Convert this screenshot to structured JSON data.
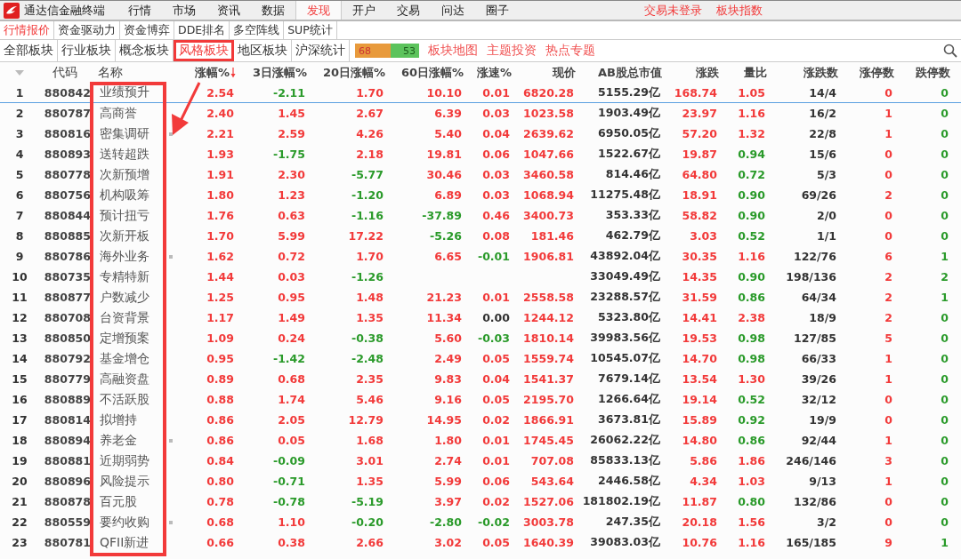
{
  "app": {
    "title": "通达信金融终端"
  },
  "menu": [
    {
      "label": "行情",
      "selected": false
    },
    {
      "label": "市场",
      "selected": false
    },
    {
      "label": "资讯",
      "selected": false
    },
    {
      "label": "数据",
      "selected": false
    },
    {
      "label": "发现",
      "selected": true
    },
    {
      "label": "开户",
      "selected": false
    },
    {
      "label": "交易",
      "selected": false
    },
    {
      "label": "问达",
      "selected": false
    },
    {
      "label": "圈子",
      "selected": false
    }
  ],
  "status_links": [
    "交易未登录",
    "板块指数"
  ],
  "sub_tabs": [
    {
      "label": "行情报价",
      "selected": true
    },
    {
      "label": "资金驱动力",
      "selected": false
    },
    {
      "label": "资金博弈",
      "selected": false
    },
    {
      "label": "DDE排名",
      "selected": false
    },
    {
      "label": "多空阵线",
      "selected": false
    },
    {
      "label": "SUP统计",
      "selected": false
    }
  ],
  "block_tabs": [
    {
      "label": "全部板块",
      "selected": false
    },
    {
      "label": "行业板块",
      "selected": false
    },
    {
      "label": "概念板块",
      "selected": false
    },
    {
      "label": "风格板块",
      "selected": true
    },
    {
      "label": "地区板块",
      "selected": false
    },
    {
      "label": "沪深统计",
      "selected": false
    }
  ],
  "breadth": {
    "up": "68",
    "down": "53",
    "level": 0.56
  },
  "links": [
    "板块地图",
    "主题投资",
    "热点专题"
  ],
  "table": {
    "columns": [
      {
        "label": "代码",
        "sorted": false
      },
      {
        "label": "名称",
        "sorted": false
      },
      {
        "label": "涨幅%",
        "sorted": true
      },
      {
        "label": "3日涨幅%",
        "sorted": false
      },
      {
        "label": "20日涨幅%",
        "sorted": false
      },
      {
        "label": "60日涨幅%",
        "sorted": false
      },
      {
        "label": "涨速%",
        "sorted": false
      },
      {
        "label": "现价",
        "sorted": false
      },
      {
        "label": "AB股总市值",
        "sorted": false
      },
      {
        "label": "涨跌",
        "sorted": false
      },
      {
        "label": "量比",
        "sorted": false
      },
      {
        "label": "涨跌数",
        "sorted": false
      },
      {
        "label": "涨停数",
        "sorted": false
      },
      {
        "label": "跌停数",
        "sorted": false
      }
    ],
    "rows": [
      {
        "rank": "1",
        "marked": false,
        "selected": true,
        "cells": [
          "880842",
          "业绩预升",
          "2.54",
          "-2.11",
          "1.70",
          "10.10",
          "0.01",
          "6820.28",
          "5155.29亿",
          "168.74",
          "1.05",
          "14/4",
          "0",
          "0"
        ]
      },
      {
        "rank": "2",
        "marked": false,
        "selected": false,
        "cells": [
          "880787",
          "高商誉",
          "2.40",
          "1.45",
          "2.67",
          "6.39",
          "0.03",
          "1023.58",
          "1903.49亿",
          "23.97",
          "1.16",
          "16/2",
          "1",
          "0"
        ]
      },
      {
        "rank": "3",
        "marked": true,
        "selected": false,
        "cells": [
          "880816",
          "密集调研",
          "2.21",
          "2.59",
          "4.26",
          "5.40",
          "0.04",
          "2639.62",
          "6950.05亿",
          "57.20",
          "1.32",
          "22/8",
          "1",
          "0"
        ]
      },
      {
        "rank": "4",
        "marked": false,
        "selected": false,
        "cells": [
          "880893",
          "送转超跌",
          "1.93",
          "-1.75",
          "2.18",
          "19.81",
          "0.06",
          "1047.66",
          "1522.67亿",
          "19.87",
          "0.94",
          "15/6",
          "0",
          "0"
        ]
      },
      {
        "rank": "5",
        "marked": false,
        "selected": false,
        "cells": [
          "880778",
          "次新预增",
          "1.91",
          "2.30",
          "-5.77",
          "30.46",
          "0.03",
          "3460.58",
          "814.46亿",
          "64.80",
          "0.72",
          "5/3",
          "0",
          "0"
        ]
      },
      {
        "rank": "6",
        "marked": false,
        "selected": false,
        "cells": [
          "880756",
          "机构吸筹",
          "1.80",
          "1.23",
          "-1.20",
          "6.89",
          "0.03",
          "1068.94",
          "11275.48亿",
          "18.91",
          "0.90",
          "69/26",
          "2",
          "0"
        ]
      },
      {
        "rank": "7",
        "marked": false,
        "selected": false,
        "cells": [
          "880844",
          "预计扭亏",
          "1.76",
          "0.63",
          "-1.16",
          "-37.89",
          "0.46",
          "3400.73",
          "353.33亿",
          "58.82",
          "0.90",
          "2/0",
          "0",
          "0"
        ]
      },
      {
        "rank": "8",
        "marked": false,
        "selected": false,
        "cells": [
          "880885",
          "次新开板",
          "1.70",
          "5.99",
          "17.22",
          "-5.26",
          "0.08",
          "181.46",
          "462.79亿",
          "3.03",
          "0.52",
          "1/1",
          "0",
          "0"
        ]
      },
      {
        "rank": "9",
        "marked": true,
        "selected": false,
        "cells": [
          "880786",
          "海外业务",
          "1.62",
          "0.72",
          "1.70",
          "6.65",
          "-0.01",
          "1906.81",
          "43892.04亿",
          "30.35",
          "1.16",
          "122/76",
          "6",
          "1"
        ]
      },
      {
        "rank": "10",
        "marked": false,
        "selected": false,
        "cells": [
          "880735",
          "专精特新",
          "1.44",
          "0.03",
          "-1.26",
          null,
          null,
          null,
          "33049.49亿",
          "14.35",
          "0.90",
          "198/136",
          "2",
          "2"
        ]
      },
      {
        "rank": "11",
        "marked": false,
        "selected": false,
        "cells": [
          "880877",
          "户数减少",
          "1.25",
          "0.95",
          "1.48",
          "21.23",
          "0.01",
          "2558.58",
          "23288.57亿",
          "31.59",
          "0.86",
          "64/34",
          "2",
          "1"
        ]
      },
      {
        "rank": "12",
        "marked": false,
        "selected": false,
        "cells": [
          "880708",
          "台资背景",
          "1.17",
          "1.49",
          "1.35",
          "11.34",
          "0.00",
          "1244.12",
          "5323.80亿",
          "14.41",
          "2.38",
          "18/9",
          "2",
          "0"
        ]
      },
      {
        "rank": "13",
        "marked": false,
        "selected": false,
        "cells": [
          "880850",
          "定增预案",
          "1.09",
          "0.24",
          "-0.38",
          "5.60",
          "-0.03",
          "1810.14",
          "39983.56亿",
          "19.53",
          "0.98",
          "127/85",
          "5",
          "0"
        ]
      },
      {
        "rank": "14",
        "marked": false,
        "selected": false,
        "cells": [
          "880792",
          "基金增仓",
          "0.95",
          "-1.42",
          "-2.48",
          "2.49",
          "0.05",
          "1559.74",
          "10545.07亿",
          "14.70",
          "0.98",
          "66/33",
          "1",
          "0"
        ]
      },
      {
        "rank": "15",
        "marked": false,
        "selected": false,
        "cells": [
          "880779",
          "高融资盘",
          "0.89",
          "0.68",
          "2.35",
          "9.83",
          "0.04",
          "1541.37",
          "7679.14亿",
          "13.54",
          "1.30",
          "39/26",
          "1",
          "0"
        ]
      },
      {
        "rank": "16",
        "marked": false,
        "selected": false,
        "cells": [
          "880889",
          "不活跃股",
          "0.88",
          "1.74",
          "5.46",
          "9.16",
          "0.05",
          "2195.70",
          "1266.64亿",
          "19.14",
          "0.52",
          "32/12",
          "0",
          "0"
        ]
      },
      {
        "rank": "17",
        "marked": false,
        "selected": false,
        "cells": [
          "880814",
          "拟增持",
          "0.86",
          "2.05",
          "12.79",
          "14.95",
          "0.02",
          "1866.91",
          "3673.81亿",
          "15.89",
          "0.92",
          "19/9",
          "0",
          "0"
        ]
      },
      {
        "rank": "18",
        "marked": true,
        "selected": false,
        "cells": [
          "880894",
          "养老金",
          "0.86",
          "0.05",
          "1.68",
          "1.80",
          "0.01",
          "1745.45",
          "26062.22亿",
          "14.80",
          "0.86",
          "92/44",
          "1",
          "0"
        ]
      },
      {
        "rank": "19",
        "marked": false,
        "selected": false,
        "cells": [
          "880881",
          "近期弱势",
          "0.84",
          "-0.09",
          "3.01",
          "2.74",
          "0.01",
          "707.08",
          "85833.13亿",
          "5.86",
          "1.86",
          "246/146",
          "3",
          "0"
        ]
      },
      {
        "rank": "20",
        "marked": false,
        "selected": false,
        "cells": [
          "880896",
          "风险提示",
          "0.80",
          "-0.71",
          "1.35",
          "5.99",
          "0.06",
          "543.64",
          "2446.58亿",
          "4.34",
          "1.03",
          "9/13",
          "1",
          "0"
        ]
      },
      {
        "rank": "21",
        "marked": false,
        "selected": false,
        "cells": [
          "880878",
          "百元股",
          "0.78",
          "-0.78",
          "-5.19",
          "3.97",
          "0.02",
          "1527.06",
          "181802.19亿",
          "11.87",
          "0.80",
          "132/86",
          "0",
          "0"
        ]
      },
      {
        "rank": "22",
        "marked": true,
        "selected": false,
        "cells": [
          "880559",
          "要约收购",
          "0.68",
          "1.10",
          "-0.20",
          "-2.80",
          "-0.02",
          "3003.78",
          "247.35亿",
          "20.18",
          "1.56",
          "3/2",
          "0",
          "0"
        ]
      },
      {
        "rank": "23",
        "marked": false,
        "selected": false,
        "cells": [
          "880781",
          "QFII新进",
          "0.66",
          "0.38",
          "2.66",
          "3.02",
          "0.05",
          "1640.39",
          "39083.03亿",
          "10.76",
          "1.16",
          "165/185",
          "9",
          "1"
        ]
      }
    ]
  }
}
